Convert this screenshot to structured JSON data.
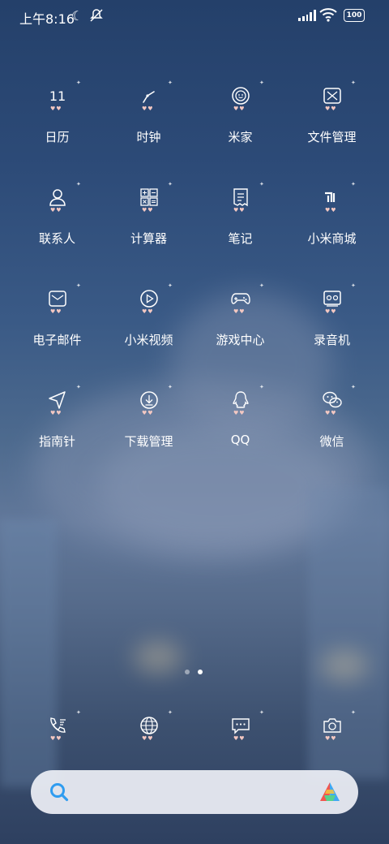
{
  "status": {
    "time": "上午8:16",
    "battery": "100"
  },
  "apps": [
    {
      "label": "日历",
      "icon": "calendar-icon",
      "num": "11"
    },
    {
      "label": "时钟",
      "icon": "clock-icon"
    },
    {
      "label": "米家",
      "icon": "mijia-icon"
    },
    {
      "label": "文件管理",
      "icon": "file-manager-icon"
    },
    {
      "label": "联系人",
      "icon": "contacts-icon"
    },
    {
      "label": "计算器",
      "icon": "calculator-icon"
    },
    {
      "label": "笔记",
      "icon": "notes-icon"
    },
    {
      "label": "小米商城",
      "icon": "mi-store-icon",
      "num": "mi"
    },
    {
      "label": "电子邮件",
      "icon": "email-icon"
    },
    {
      "label": "小米视频",
      "icon": "video-icon"
    },
    {
      "label": "游戏中心",
      "icon": "game-center-icon"
    },
    {
      "label": "录音机",
      "icon": "recorder-icon"
    },
    {
      "label": "指南针",
      "icon": "compass-icon"
    },
    {
      "label": "下载管理",
      "icon": "download-icon"
    },
    {
      "label": "QQ",
      "icon": "qq-icon"
    },
    {
      "label": "微信",
      "icon": "wechat-icon"
    }
  ],
  "dock": [
    {
      "icon": "phone-icon"
    },
    {
      "icon": "browser-icon"
    },
    {
      "icon": "messages-icon"
    },
    {
      "icon": "camera-icon"
    }
  ],
  "pages": {
    "count": 2,
    "current": 2
  },
  "colors": {
    "background": "#2d4b78",
    "search_bar": "#eef0f6",
    "search_icon": "#2f9cf0"
  }
}
